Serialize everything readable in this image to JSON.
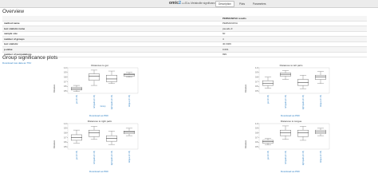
{
  "app": {
    "logo_main": "omic",
    "logo_two": "2",
    "logo_suffix": ".com",
    "breadcrumb": "T1a. Metabolite significance plots",
    "tabs": [
      {
        "label": "Description",
        "active": true
      },
      {
        "label": "Plots",
        "active": false
      },
      {
        "label": "Parameters",
        "active": false
      }
    ]
  },
  "overview": {
    "title": "Overview",
    "header_value": "PERMANOVA results",
    "rows": [
      {
        "key": "method name",
        "value": "PERMANOVA"
      },
      {
        "key": "test statistic name",
        "value": "pseudo-F"
      },
      {
        "key": "sample size",
        "value": "60"
      },
      {
        "key": "number of groups",
        "value": "4"
      },
      {
        "key": "test statistic",
        "value": "40.3409"
      },
      {
        "key": "p-value",
        "value": "0.001"
      },
      {
        "key": "number of permutations",
        "value": "999"
      }
    ]
  },
  "plots_section": {
    "title": "Group significance plots",
    "download_all": "Download raw data as TSV"
  },
  "chart_data": [
    {
      "type": "box",
      "title": "Distances to gut",
      "xlabel": "Group",
      "ylabel": "Distance",
      "categories": [
        "gut (n=15)",
        "left palm (n=15)",
        "right palm (n=15)",
        "tongue (n=15)"
      ],
      "ylim": [
        0.45,
        1.0
      ],
      "yticks": [
        0.5,
        0.6,
        0.7,
        0.8,
        0.9,
        1.0
      ],
      "boxes": [
        {
          "min": 0.49,
          "q1": 0.52,
          "median": 0.55,
          "q3": 0.58,
          "max": 0.62
        },
        {
          "min": 0.62,
          "q1": 0.73,
          "median": 0.82,
          "q3": 0.87,
          "max": 0.95
        },
        {
          "min": 0.66,
          "q1": 0.7,
          "median": 0.76,
          "q3": 0.84,
          "max": 0.93
        },
        {
          "min": 0.8,
          "q1": 0.82,
          "median": 0.85,
          "q3": 0.87,
          "max": 0.9
        }
      ],
      "download_label": "Download as PDF"
    },
    {
      "type": "box",
      "title": "Distances to left palm",
      "xlabel": "",
      "ylabel": "Distance",
      "categories": [
        "gut (n=15)",
        "left palm (n=15)",
        "right palm (n=15)",
        "tongue (n=15)"
      ],
      "ylim": [
        0.45,
        1.0
      ],
      "yticks": [
        0.5,
        0.6,
        0.7,
        0.8,
        0.9,
        1.0
      ],
      "boxes": [
        {
          "min": 0.56,
          "q1": 0.62,
          "median": 0.66,
          "q3": 0.72,
          "max": 0.8
        },
        {
          "min": 0.75,
          "q1": 0.82,
          "median": 0.86,
          "q3": 0.89,
          "max": 0.94
        },
        {
          "min": 0.55,
          "q1": 0.62,
          "median": 0.68,
          "q3": 0.75,
          "max": 0.84
        },
        {
          "min": 0.66,
          "q1": 0.75,
          "median": 0.8,
          "q3": 0.84,
          "max": 0.92
        }
      ],
      "download_label": "Download as PDF"
    },
    {
      "type": "box",
      "title": "Distances to right palm",
      "xlabel": "",
      "ylabel": "Distance",
      "categories": [
        "gut (n=15)",
        "left palm (n=15)",
        "right palm (n=15)",
        "tongue (n=15)"
      ],
      "ylim": [
        0.45,
        1.0
      ],
      "yticks": [
        0.5,
        0.6,
        0.7,
        0.8,
        0.9,
        1.0
      ],
      "boxes": [
        {
          "min": 0.58,
          "q1": 0.64,
          "median": 0.7,
          "q3": 0.76,
          "max": 0.86
        },
        {
          "min": 0.66,
          "q1": 0.72,
          "median": 0.8,
          "q3": 0.86,
          "max": 0.94
        },
        {
          "min": 0.55,
          "q1": 0.62,
          "median": 0.68,
          "q3": 0.74,
          "max": 0.84
        },
        {
          "min": 0.74,
          "q1": 0.78,
          "median": 0.82,
          "q3": 0.84,
          "max": 0.9
        }
      ],
      "download_label": "Download as PDF"
    },
    {
      "type": "box",
      "title": "Distances to tongue",
      "xlabel": "",
      "ylabel": "Distance",
      "categories": [
        "gut (n=15)",
        "left palm (n=15)",
        "right palm (n=15)",
        "tongue (n=15)"
      ],
      "ylim": [
        0.45,
        1.0
      ],
      "yticks": [
        0.5,
        0.6,
        0.7,
        0.8,
        0.9,
        1.0
      ],
      "boxes": [
        {
          "min": 0.54,
          "q1": 0.58,
          "median": 0.61,
          "q3": 0.64,
          "max": 0.68
        },
        {
          "min": 0.66,
          "q1": 0.74,
          "median": 0.8,
          "q3": 0.86,
          "max": 0.95
        },
        {
          "min": 0.64,
          "q1": 0.72,
          "median": 0.8,
          "q3": 0.86,
          "max": 0.94
        },
        {
          "min": 0.74,
          "q1": 0.78,
          "median": 0.82,
          "q3": 0.86,
          "max": 0.9
        }
      ],
      "download_label": "Download as PDF"
    }
  ],
  "colors": {
    "link": "#2c7fc4",
    "box_edge": "#444444"
  }
}
